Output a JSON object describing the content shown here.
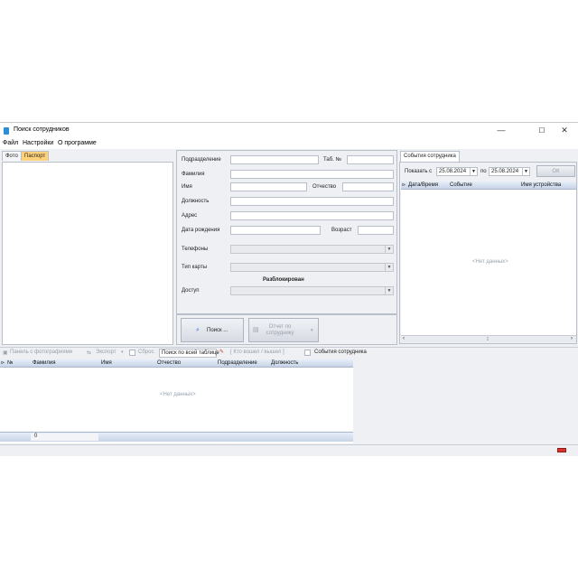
{
  "window": {
    "title": "Поиск сотрудников",
    "controls": {
      "minimize": "—",
      "maximize": "☐",
      "close": "✕"
    }
  },
  "menu": [
    "Файл",
    "Настройки",
    "О программе"
  ],
  "left_panel": {
    "tabs": [
      "Фото",
      "Паспорт"
    ],
    "active_tab": "Паспорт"
  },
  "form": {
    "labels": {
      "department": "Подразделение",
      "tab_no": "Таб. №",
      "surname": "Фамилия",
      "name": "Имя",
      "patronymic": "Отчество",
      "position": "Должность",
      "address": "Адрес",
      "birth_date": "Дата рождения",
      "age": "Возраст",
      "phones": "Телефоны",
      "card_type": "Тип карты",
      "access": "Доступ"
    },
    "status": "Разблокирован",
    "search_button": "Поиск ...",
    "report_button": "Отчет по сотруднику"
  },
  "events_panel": {
    "tab": "События сотрудника",
    "show_from_label": "Показать с",
    "from_date": "25.08.2024",
    "to_label": "по",
    "to_date": "25.08.2024",
    "ok_button": "ОК",
    "columns": [
      "Дата/Время",
      "Событие",
      "Имя устройства"
    ],
    "empty": "<Нет данных>"
  },
  "toolbar": {
    "photo_panel": "Панель с фотографиями",
    "export": "Экспорт",
    "reset": "Сброс",
    "search_all_placeholder": "Поиск по всей таблице",
    "who_entered": "[ Кто вошел / вышел ]",
    "employee_events": "События сотрудника"
  },
  "grid": {
    "columns": [
      "№",
      "Фамилия",
      "Имя",
      "Отчество",
      "Подразделение",
      "Должность"
    ],
    "empty": "<Нет данных>",
    "footer_count": "0"
  },
  "colors": {
    "active_tab": "#ffd27a",
    "header_gradient_top": "#e6eef9",
    "header_gradient_bottom": "#c7d4e6",
    "status_indicator": "#d9302c"
  }
}
